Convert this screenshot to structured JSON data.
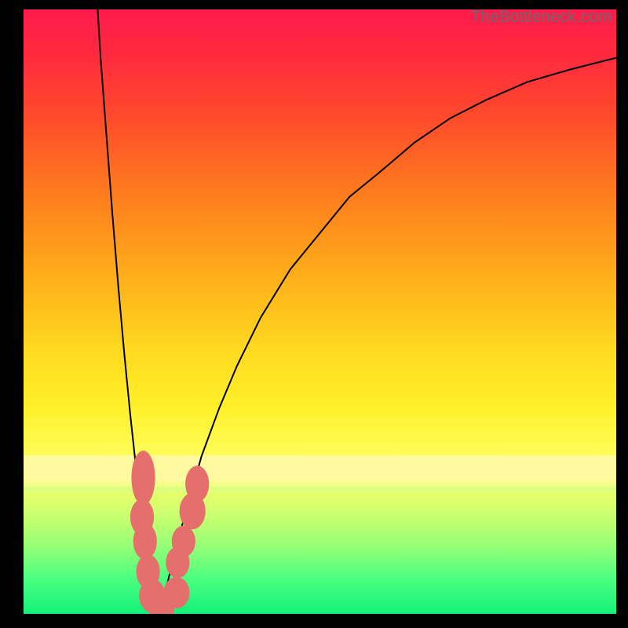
{
  "watermark": "TheBottleneck.com",
  "chart_data": {
    "type": "line",
    "title": "",
    "xlabel": "",
    "ylabel": "",
    "xlim": [
      0,
      100
    ],
    "ylim": [
      0,
      100
    ],
    "grid": false,
    "legend": false,
    "series": [
      {
        "name": "left-curve",
        "x": [
          12.5,
          13.0,
          14.0,
          15.0,
          16.0,
          17.0,
          18.0,
          19.0,
          20.0,
          21.0,
          22.0,
          22.7
        ],
        "values": [
          100,
          92,
          79,
          66,
          54,
          43,
          33,
          24,
          16,
          9,
          3,
          0
        ]
      },
      {
        "name": "right-curve",
        "x": [
          22.7,
          24,
          26,
          28,
          30,
          33,
          36,
          40,
          45,
          50,
          55,
          60,
          66,
          72,
          78,
          85,
          92,
          100
        ],
        "values": [
          0,
          4,
          12,
          19,
          26,
          34,
          41,
          49,
          57,
          63,
          69,
          73,
          78,
          82,
          85,
          88,
          90,
          92
        ]
      }
    ],
    "markers": [
      {
        "x": 20.2,
        "y": 22.5,
        "rx": 2.0,
        "ry": 4.5
      },
      {
        "x": 20.0,
        "y": 16.0,
        "rx": 2.0,
        "ry": 3.0
      },
      {
        "x": 20.5,
        "y": 12.0,
        "rx": 2.0,
        "ry": 3.0
      },
      {
        "x": 21.0,
        "y": 7.0,
        "rx": 2.0,
        "ry": 2.8
      },
      {
        "x": 21.7,
        "y": 3.0,
        "rx": 2.2,
        "ry": 2.8
      },
      {
        "x": 23.3,
        "y": 1.0,
        "rx": 2.2,
        "ry": 2.5
      },
      {
        "x": 25.8,
        "y": 3.5,
        "rx": 2.2,
        "ry": 2.6
      },
      {
        "x": 26.0,
        "y": 8.5,
        "rx": 2.0,
        "ry": 2.6
      },
      {
        "x": 27.0,
        "y": 12.0,
        "rx": 2.0,
        "ry": 2.6
      },
      {
        "x": 28.5,
        "y": 17.0,
        "rx": 2.2,
        "ry": 3.0
      },
      {
        "x": 29.3,
        "y": 21.5,
        "rx": 2.0,
        "ry": 3.0
      }
    ],
    "background_gradient": {
      "direction": "vertical",
      "stops": [
        {
          "pos": 0.0,
          "color": "#ff1a4d"
        },
        {
          "pos": 0.3,
          "color": "#ff7a1e"
        },
        {
          "pos": 0.6,
          "color": "#ffe820"
        },
        {
          "pos": 0.8,
          "color": "#e8ff66"
        },
        {
          "pos": 1.0,
          "color": "#14f07a"
        }
      ]
    },
    "bands": [
      {
        "top": 73.8,
        "height": 4.2,
        "color": "#fff9a0"
      },
      {
        "top": 78.0,
        "height": 1.0,
        "color": "#f2ff8a"
      },
      {
        "top": 79.0,
        "height": 1.0,
        "color": "#dfff7e"
      }
    ]
  },
  "colors": {
    "curve": "#000000",
    "marker_fill": "#e46f6c",
    "marker_stroke": "#e46f6c",
    "frame": "#000000"
  }
}
